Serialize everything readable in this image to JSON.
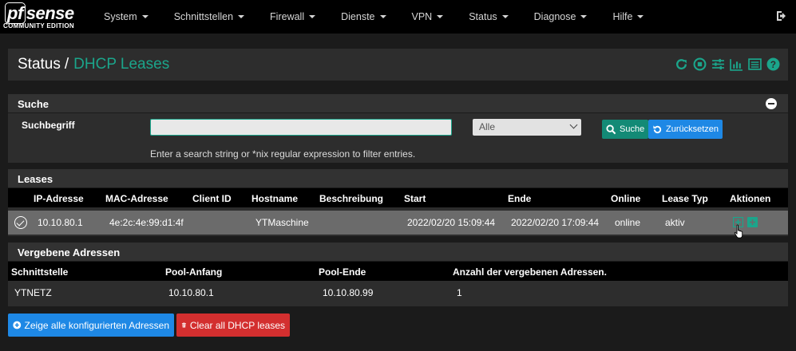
{
  "navbar": {
    "brand": {
      "logo_pf": "pf",
      "logo_sense": "sense",
      "edition": "COMMUNITY EDITION"
    },
    "menu": [
      {
        "label": "System"
      },
      {
        "label": "Schnittstellen"
      },
      {
        "label": "Firewall"
      },
      {
        "label": "Dienste"
      },
      {
        "label": "VPN"
      },
      {
        "label": "Status"
      },
      {
        "label": "Diagnose"
      },
      {
        "label": "Hilfe"
      }
    ],
    "logout_icon": "sign-out-icon"
  },
  "header": {
    "breadcrumb_root": "Status",
    "separator": "/",
    "breadcrumb_page": "DHCP Leases",
    "icons": [
      "refresh-icon",
      "stop-icon",
      "sliders-icon",
      "chart-icon",
      "list-icon",
      "help-icon"
    ]
  },
  "search": {
    "title": "Suche",
    "label": "Suchbegriff",
    "input_value": "",
    "select_value": "Alle",
    "search_button": "Suche",
    "reset_button": "Zurücksetzen",
    "help_text": "Enter a search string or *nix regular expression to filter entries."
  },
  "leases": {
    "title": "Leases",
    "columns": [
      "IP-Adresse",
      "MAC-Adresse",
      "Client ID",
      "Hostname",
      "Beschreibung",
      "Start",
      "Ende",
      "Online",
      "Lease Typ",
      "Aktionen"
    ],
    "rows": [
      {
        "ip": "10.10.80.1",
        "mac": "4e:2c:4e:99:d1:4f",
        "client_id": "",
        "hostname": "YTMaschine",
        "description": "",
        "start": "2022/02/20 15:09:44",
        "end": "2022/02/20 17:09:44",
        "online": "online",
        "lease_type": "aktiv"
      }
    ]
  },
  "assigned": {
    "title": "Vergebene Adressen",
    "columns": [
      "Schnittstelle",
      "Pool-Anfang",
      "Pool-Ende",
      "Anzahl der vergebenen Adressen."
    ],
    "rows": [
      {
        "interface": "YTNETZ",
        "pool_start": "10.10.80.1",
        "pool_end": "10.10.80.99",
        "count": "1"
      }
    ]
  },
  "buttons": {
    "show_all": "Zeige alle konfigurierten Adressen",
    "clear": "Clear all DHCP leases"
  },
  "colors": {
    "accent": "#1ba58b",
    "blue": "#1e88e5",
    "red": "#d32f2f",
    "green_button": "#138a76"
  }
}
